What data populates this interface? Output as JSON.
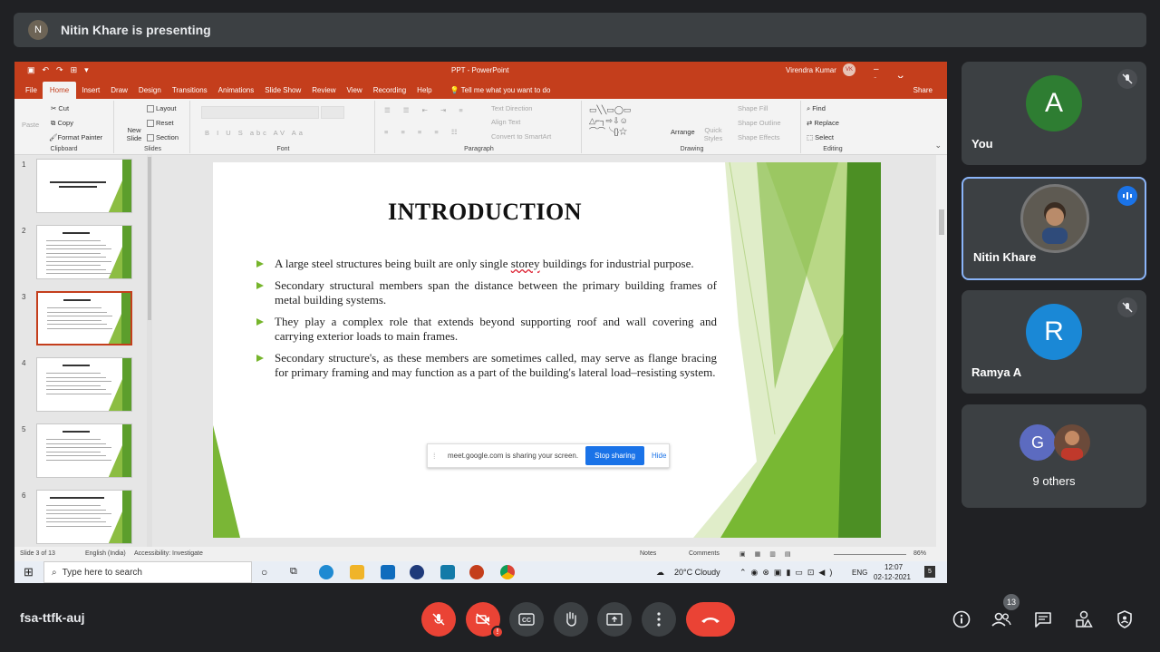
{
  "meet": {
    "presenter_banner": "Nitin Khare is presenting",
    "meeting_code": "fsa-ttfk-auj",
    "participant_count_badge": "13"
  },
  "powerpoint": {
    "window_title": "PPT - PowerPoint",
    "user_name": "Virendra Kumar",
    "user_initials": "VK",
    "tabs": [
      "File",
      "Home",
      "Insert",
      "Draw",
      "Design",
      "Transitions",
      "Animations",
      "Slide Show",
      "Review",
      "View",
      "Recording",
      "Help"
    ],
    "active_tab": "Home",
    "tell_me": "Tell me what you want to do",
    "share_label": "Share",
    "ribbon": {
      "clipboard": {
        "label": "Clipboard",
        "paste": "Paste",
        "cut": "Cut",
        "copy": "Copy",
        "format_painter": "Format Painter"
      },
      "slides": {
        "label": "Slides",
        "new_slide": "New Slide",
        "layout": "Layout",
        "reset": "Reset",
        "section": "Section"
      },
      "font": {
        "label": "Font",
        "buttons": "B  I  U  S  abc  AV  Aa"
      },
      "paragraph": {
        "label": "Paragraph",
        "text_direction": "Text Direction",
        "align_text": "Align Text",
        "smartart": "Convert to SmartArt"
      },
      "drawing": {
        "label": "Drawing",
        "arrange": "Arrange",
        "quick_styles": "Quick Styles",
        "shape_fill": "Shape Fill",
        "shape_outline": "Shape Outline",
        "shape_effects": "Shape Effects"
      },
      "editing": {
        "label": "Editing",
        "find": "Find",
        "replace": "Replace",
        "select": "Select"
      }
    },
    "thumbnails": [
      "1",
      "2",
      "3",
      "4",
      "5",
      "6"
    ],
    "selected_slide": "3",
    "slide": {
      "title": "INTRODUCTION",
      "bullets": [
        {
          "pre": "A large steel structures being built are only single ",
          "mark": "storey",
          "post": " buildings for industrial purpose."
        },
        {
          "pre": "Secondary structural members span the distance between the primary building frames of metal building systems.",
          "mark": "",
          "post": ""
        },
        {
          "pre": "They play a complex role that extends beyond supporting roof and wall covering and carrying exterior loads to main frames.",
          "mark": "",
          "post": ""
        },
        {
          "pre": "Secondary structure's, as these members are sometimes called, may serve as flange bracing for primary framing and may function as a part of the building's lateral load–resisting system.",
          "mark": "",
          "post": ""
        }
      ]
    },
    "share_bar": {
      "message": "meet.google.com is sharing your screen.",
      "stop": "Stop sharing",
      "hide": "Hide"
    },
    "status": {
      "slide_of": "Slide 3 of 13",
      "language": "English (India)",
      "accessibility": "Accessibility: Investigate",
      "notes": "Notes",
      "comments": "Comments",
      "zoom": "86%"
    }
  },
  "taskbar": {
    "search_placeholder": "Type here to search",
    "weather": "20°C  Cloudy",
    "lang": "ENG",
    "time": "12:07",
    "date": "02-12-2021",
    "notif_count": "5"
  },
  "participants": [
    {
      "name": "You",
      "initial": "A",
      "color": "#2e7d32"
    },
    {
      "name": "Nitin Khare"
    },
    {
      "name": "Ramya A",
      "initial": "R",
      "color": "#1a88d6"
    },
    {
      "name": "9 others",
      "initial": "G",
      "color": "#5c6bc0"
    }
  ]
}
